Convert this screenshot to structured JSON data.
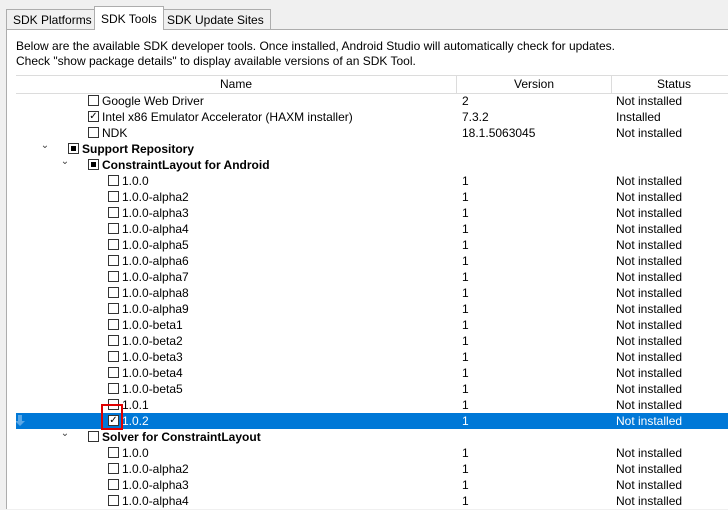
{
  "tabs": [
    {
      "label": "SDK Platforms",
      "active": false
    },
    {
      "label": "SDK Tools",
      "active": true
    },
    {
      "label": "SDK Update Sites",
      "active": false
    }
  ],
  "description": {
    "line1": "Below are the available SDK developer tools. Once installed, Android Studio will automatically check for updates.",
    "line2": "Check \"show package details\" to display available versions of an SDK Tool."
  },
  "columns": {
    "name": "Name",
    "version": "Version",
    "status": "Status"
  },
  "rows": [
    {
      "indent": 2,
      "expand": null,
      "check": "unchecked",
      "name": "Google Web Driver",
      "version": "2",
      "status": "Not installed",
      "bold": false,
      "selected": false
    },
    {
      "indent": 2,
      "expand": null,
      "check": "checked",
      "name": "Intel x86 Emulator Accelerator (HAXM installer)",
      "version": "7.3.2",
      "status": "Installed",
      "bold": false,
      "selected": false
    },
    {
      "indent": 2,
      "expand": null,
      "check": "unchecked",
      "name": "NDK",
      "version": "18.1.5063045",
      "status": "Not installed",
      "bold": false,
      "selected": false
    },
    {
      "indent": 1,
      "expand": "open",
      "check": "partial",
      "name": "Support Repository",
      "version": "",
      "status": "",
      "bold": true,
      "selected": false
    },
    {
      "indent": 2,
      "expand": "open",
      "check": "partial",
      "name": "ConstraintLayout for Android",
      "version": "",
      "status": "",
      "bold": true,
      "selected": false
    },
    {
      "indent": 3,
      "expand": null,
      "check": "unchecked",
      "name": "1.0.0",
      "version": "1",
      "status": "Not installed",
      "bold": false,
      "selected": false
    },
    {
      "indent": 3,
      "expand": null,
      "check": "unchecked",
      "name": "1.0.0-alpha2",
      "version": "1",
      "status": "Not installed",
      "bold": false,
      "selected": false
    },
    {
      "indent": 3,
      "expand": null,
      "check": "unchecked",
      "name": "1.0.0-alpha3",
      "version": "1",
      "status": "Not installed",
      "bold": false,
      "selected": false
    },
    {
      "indent": 3,
      "expand": null,
      "check": "unchecked",
      "name": "1.0.0-alpha4",
      "version": "1",
      "status": "Not installed",
      "bold": false,
      "selected": false
    },
    {
      "indent": 3,
      "expand": null,
      "check": "unchecked",
      "name": "1.0.0-alpha5",
      "version": "1",
      "status": "Not installed",
      "bold": false,
      "selected": false
    },
    {
      "indent": 3,
      "expand": null,
      "check": "unchecked",
      "name": "1.0.0-alpha6",
      "version": "1",
      "status": "Not installed",
      "bold": false,
      "selected": false
    },
    {
      "indent": 3,
      "expand": null,
      "check": "unchecked",
      "name": "1.0.0-alpha7",
      "version": "1",
      "status": "Not installed",
      "bold": false,
      "selected": false
    },
    {
      "indent": 3,
      "expand": null,
      "check": "unchecked",
      "name": "1.0.0-alpha8",
      "version": "1",
      "status": "Not installed",
      "bold": false,
      "selected": false
    },
    {
      "indent": 3,
      "expand": null,
      "check": "unchecked",
      "name": "1.0.0-alpha9",
      "version": "1",
      "status": "Not installed",
      "bold": false,
      "selected": false
    },
    {
      "indent": 3,
      "expand": null,
      "check": "unchecked",
      "name": "1.0.0-beta1",
      "version": "1",
      "status": "Not installed",
      "bold": false,
      "selected": false
    },
    {
      "indent": 3,
      "expand": null,
      "check": "unchecked",
      "name": "1.0.0-beta2",
      "version": "1",
      "status": "Not installed",
      "bold": false,
      "selected": false
    },
    {
      "indent": 3,
      "expand": null,
      "check": "unchecked",
      "name": "1.0.0-beta3",
      "version": "1",
      "status": "Not installed",
      "bold": false,
      "selected": false
    },
    {
      "indent": 3,
      "expand": null,
      "check": "unchecked",
      "name": "1.0.0-beta4",
      "version": "1",
      "status": "Not installed",
      "bold": false,
      "selected": false
    },
    {
      "indent": 3,
      "expand": null,
      "check": "unchecked",
      "name": "1.0.0-beta5",
      "version": "1",
      "status": "Not installed",
      "bold": false,
      "selected": false
    },
    {
      "indent": 3,
      "expand": null,
      "check": "unchecked",
      "name": "1.0.1",
      "version": "1",
      "status": "Not installed",
      "bold": false,
      "selected": false
    },
    {
      "indent": 3,
      "expand": null,
      "check": "checked",
      "name": "1.0.2",
      "version": "1",
      "status": "Not installed",
      "bold": false,
      "selected": true,
      "download_icon": true
    },
    {
      "indent": 2,
      "expand": "open",
      "check": "unchecked",
      "name": "Solver for ConstraintLayout",
      "version": "",
      "status": "",
      "bold": true,
      "selected": false
    },
    {
      "indent": 3,
      "expand": null,
      "check": "unchecked",
      "name": "1.0.0",
      "version": "1",
      "status": "Not installed",
      "bold": false,
      "selected": false
    },
    {
      "indent": 3,
      "expand": null,
      "check": "unchecked",
      "name": "1.0.0-alpha2",
      "version": "1",
      "status": "Not installed",
      "bold": false,
      "selected": false
    },
    {
      "indent": 3,
      "expand": null,
      "check": "unchecked",
      "name": "1.0.0-alpha3",
      "version": "1",
      "status": "Not installed",
      "bold": false,
      "selected": false
    },
    {
      "indent": 3,
      "expand": null,
      "check": "unchecked",
      "name": "1.0.0-alpha4",
      "version": "1",
      "status": "Not installed",
      "bold": false,
      "selected": false
    }
  ],
  "icons": {
    "expand": "chevron-down-icon",
    "check": "checkmark-icon",
    "download": "download-arrow-icon"
  },
  "colors": {
    "selection": "#0078d7",
    "highlight_box": "#e00000"
  }
}
